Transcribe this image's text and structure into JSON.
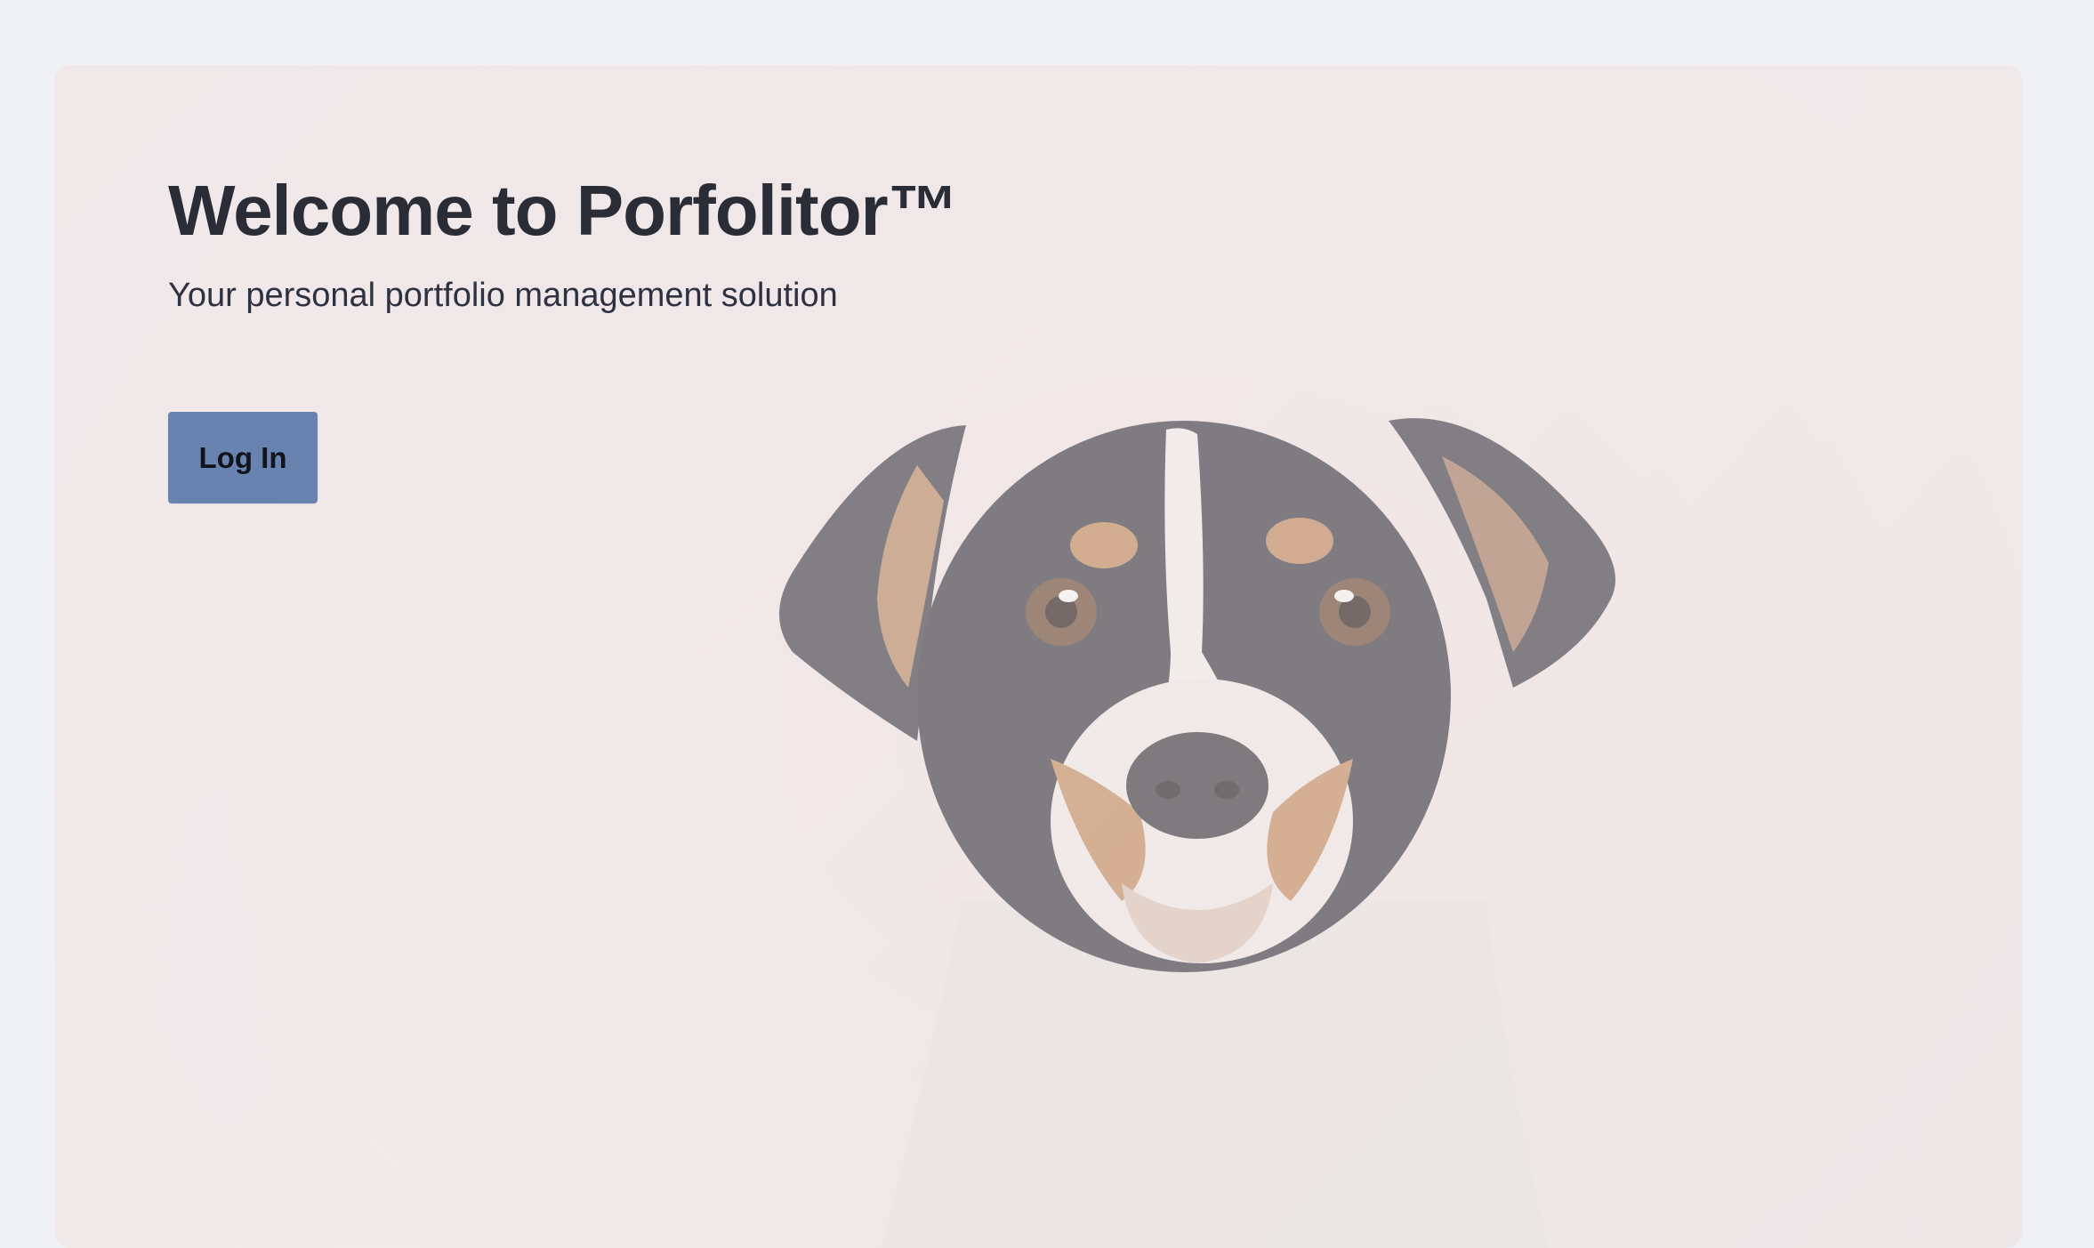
{
  "hero": {
    "title": "Welcome to Porfolitor™",
    "subtitle": "Your personal portfolio management solution",
    "login_label": "Log In",
    "background_image": "dog-portrait",
    "colors": {
      "page_background": "#eff0f4",
      "title_text": "#2a2d36",
      "button_background": "#6983b0"
    }
  }
}
